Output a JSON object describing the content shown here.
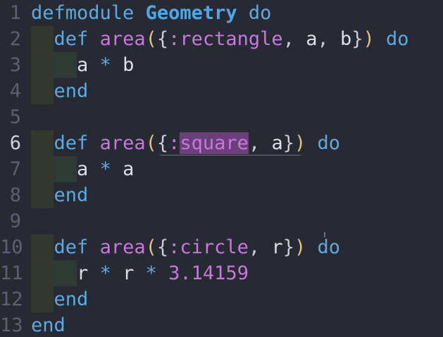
{
  "editor": {
    "current_line": "6",
    "lines": [
      {
        "num": "1",
        "tokens": [
          {
            "t": "defmodule",
            "c": "kw"
          },
          {
            "t": " ",
            "c": "var"
          },
          {
            "t": "Geometry",
            "c": "mod"
          },
          {
            "t": " ",
            "c": "var"
          },
          {
            "t": "do",
            "c": "kw"
          }
        ]
      },
      {
        "num": "2",
        "tokens": [
          {
            "t": "  ",
            "c": "var"
          },
          {
            "t": "def",
            "c": "kw"
          },
          {
            "t": " ",
            "c": "var"
          },
          {
            "t": "area",
            "c": "fn"
          },
          {
            "t": "(",
            "c": "br"
          },
          {
            "t": "{",
            "c": "punc"
          },
          {
            "t": ":rectangle",
            "c": "atom"
          },
          {
            "t": ", ",
            "c": "punc"
          },
          {
            "t": "a",
            "c": "var"
          },
          {
            "t": ", ",
            "c": "punc"
          },
          {
            "t": "b",
            "c": "var"
          },
          {
            "t": "}",
            "c": "punc"
          },
          {
            "t": ")",
            "c": "br"
          },
          {
            "t": " ",
            "c": "var"
          },
          {
            "t": "do",
            "c": "kw"
          }
        ]
      },
      {
        "num": "3",
        "tokens": [
          {
            "t": "    ",
            "c": "var"
          },
          {
            "t": "a",
            "c": "var"
          },
          {
            "t": " ",
            "c": "var"
          },
          {
            "t": "*",
            "c": "op"
          },
          {
            "t": " ",
            "c": "var"
          },
          {
            "t": "b",
            "c": "var"
          }
        ]
      },
      {
        "num": "4",
        "tokens": [
          {
            "t": "  ",
            "c": "var"
          },
          {
            "t": "end",
            "c": "kw"
          }
        ]
      },
      {
        "num": "5",
        "tokens": []
      },
      {
        "num": "6",
        "tokens": [
          {
            "t": "  ",
            "c": "var"
          },
          {
            "t": "def",
            "c": "kw"
          },
          {
            "t": " ",
            "c": "var"
          },
          {
            "t": "area",
            "c": "fn"
          },
          {
            "t": "(",
            "c": "br"
          },
          {
            "t": "{",
            "c": "punc"
          },
          {
            "t": ":",
            "c": "atom"
          },
          {
            "t": "square",
            "c": "hl"
          },
          {
            "t": ", ",
            "c": "punc"
          },
          {
            "t": "a",
            "c": "var"
          },
          {
            "t": "}",
            "c": "punc"
          },
          {
            "t": ")",
            "c": "br"
          },
          {
            "t": " ",
            "c": "var"
          },
          {
            "t": "do",
            "c": "kw"
          }
        ]
      },
      {
        "num": "7",
        "tokens": [
          {
            "t": "    ",
            "c": "var"
          },
          {
            "t": "a",
            "c": "var"
          },
          {
            "t": " ",
            "c": "var"
          },
          {
            "t": "*",
            "c": "op"
          },
          {
            "t": " ",
            "c": "var"
          },
          {
            "t": "a",
            "c": "var"
          }
        ]
      },
      {
        "num": "8",
        "tokens": [
          {
            "t": "  ",
            "c": "var"
          },
          {
            "t": "end",
            "c": "kw"
          }
        ]
      },
      {
        "num": "9",
        "tokens": []
      },
      {
        "num": "10",
        "tokens": [
          {
            "t": "  ",
            "c": "var"
          },
          {
            "t": "def",
            "c": "kw"
          },
          {
            "t": " ",
            "c": "var"
          },
          {
            "t": "area",
            "c": "fn"
          },
          {
            "t": "(",
            "c": "br"
          },
          {
            "t": "{",
            "c": "punc"
          },
          {
            "t": ":circle",
            "c": "atom"
          },
          {
            "t": ", ",
            "c": "punc"
          },
          {
            "t": "r",
            "c": "var"
          },
          {
            "t": "}",
            "c": "punc"
          },
          {
            "t": ")",
            "c": "br"
          },
          {
            "t": " ",
            "c": "var"
          },
          {
            "t": "do",
            "c": "kw"
          }
        ]
      },
      {
        "num": "11",
        "tokens": [
          {
            "t": "    ",
            "c": "var"
          },
          {
            "t": "r",
            "c": "var"
          },
          {
            "t": " ",
            "c": "var"
          },
          {
            "t": "*",
            "c": "op"
          },
          {
            "t": " ",
            "c": "var"
          },
          {
            "t": "r",
            "c": "var"
          },
          {
            "t": " ",
            "c": "var"
          },
          {
            "t": "*",
            "c": "op"
          },
          {
            "t": " ",
            "c": "var"
          },
          {
            "t": "3.14159",
            "c": "num"
          }
        ]
      },
      {
        "num": "12",
        "tokens": [
          {
            "t": "  ",
            "c": "var"
          },
          {
            "t": "end",
            "c": "kw"
          }
        ]
      },
      {
        "num": "13",
        "tokens": [
          {
            "t": "end",
            "c": "kw"
          }
        ]
      }
    ]
  },
  "colors": {
    "background": "#282a33",
    "keyword": "#5fa8e0",
    "function": "#c678dd",
    "bracket": "#e5c07b",
    "selection_highlight": "#6b3f7a"
  }
}
